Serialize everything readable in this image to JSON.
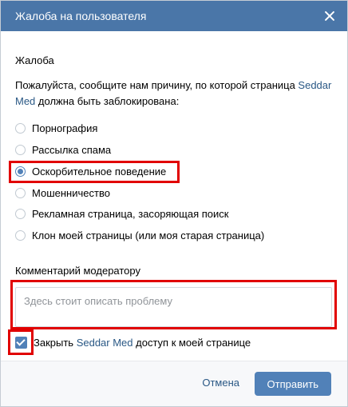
{
  "dialog": {
    "title": "Жалоба на пользователя"
  },
  "complaint": {
    "section_title": "Жалоба",
    "desc_before": "Пожалуйста, сообщите нам причину, по которой страница ",
    "user_name": "Seddar Med",
    "desc_after": " должна быть заблокирована:",
    "options": [
      {
        "label": "Порнография",
        "checked": false
      },
      {
        "label": "Рассылка спама",
        "checked": false
      },
      {
        "label": "Оскорбительное поведение",
        "checked": true
      },
      {
        "label": "Мошенничество",
        "checked": false
      },
      {
        "label": "Рекламная страница, засоряющая поиск",
        "checked": false
      },
      {
        "label": "Клон моей страницы (или моя старая страница)",
        "checked": false
      }
    ]
  },
  "comment": {
    "section_title": "Комментарий модератору",
    "placeholder": "Здесь стоит описать проблему",
    "value": ""
  },
  "close_access": {
    "checked": true,
    "label_before": "Закрыть ",
    "user_name": "Seddar Med",
    "label_after": " доступ к моей странице"
  },
  "footer": {
    "cancel_label": "Отмена",
    "submit_label": "Отправить"
  },
  "colors": {
    "header": "#4a76a8",
    "accent": "#5181b8",
    "link": "#2a5885",
    "highlight": "#e10000"
  }
}
